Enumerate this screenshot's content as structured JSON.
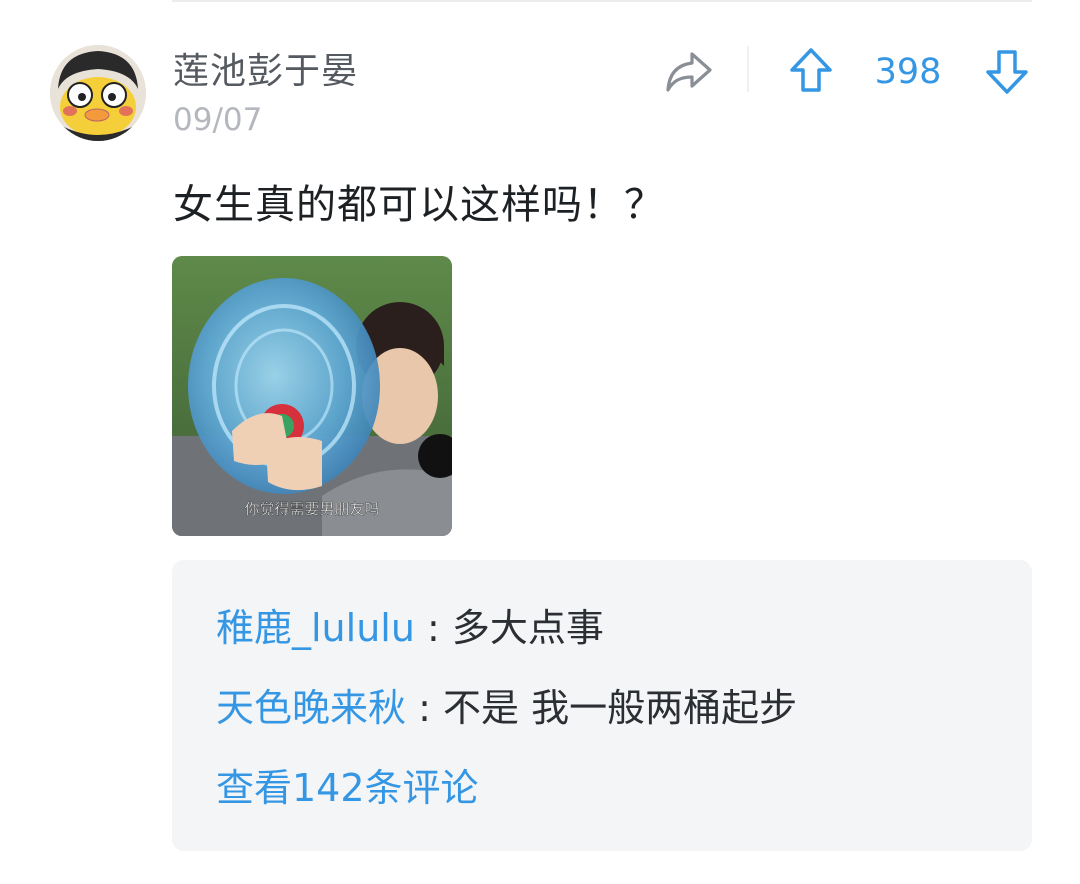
{
  "post": {
    "author": "莲池彭于晏",
    "date": "09/07",
    "text": "女生真的都可以这样吗！？",
    "vote_count": "398",
    "image_caption": "你觉得需要男朋友吗"
  },
  "icons": {
    "share": "share-arrow-icon",
    "upvote": "arrow-up-icon",
    "downvote": "arrow-down-icon"
  },
  "comments": [
    {
      "author": "稚鹿_lululu",
      "separator": " : ",
      "text": "多大点事"
    },
    {
      "author": "天色晚来秋",
      "separator": " : ",
      "text": "不是 我一般两桶起步"
    }
  ],
  "view_all": "查看142条评论",
  "colors": {
    "accent": "#3597e4",
    "username": "#555a60",
    "date": "#b4b8be",
    "comments_bg": "#f4f5f7"
  }
}
